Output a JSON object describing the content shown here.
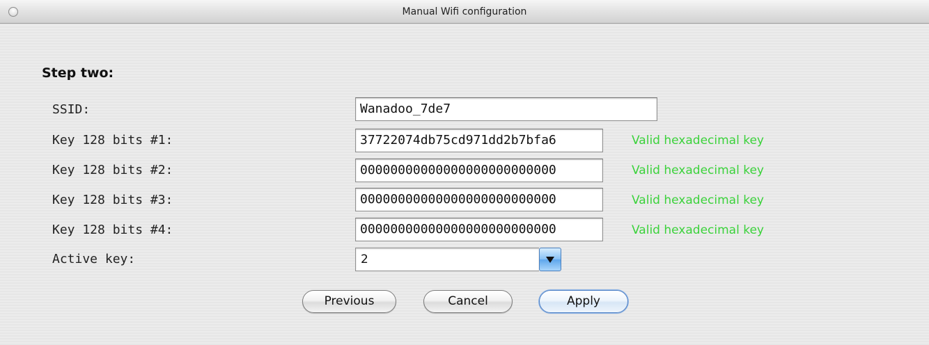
{
  "window": {
    "title": "Manual Wifi configuration"
  },
  "form": {
    "heading": "Step two:",
    "ssid": {
      "label": "SSID:",
      "value": "Wanadoo_7de7"
    },
    "keys": [
      {
        "label": "Key 128 bits #1:",
        "value": "37722074db75cd971dd2b7bfa6",
        "status": "Valid hexadecimal key"
      },
      {
        "label": "Key 128 bits #2:",
        "value": "00000000000000000000000000",
        "status": "Valid hexadecimal key"
      },
      {
        "label": "Key 128 bits #3:",
        "value": "00000000000000000000000000",
        "status": "Valid hexadecimal key"
      },
      {
        "label": "Key 128 bits #4:",
        "value": "00000000000000000000000000",
        "status": "Valid hexadecimal key"
      }
    ],
    "active_key": {
      "label": "Active key:",
      "value": "2"
    }
  },
  "buttons": {
    "previous": "Previous",
    "cancel": "Cancel",
    "apply": "Apply"
  },
  "colors": {
    "valid_status": "#3bd23b",
    "default_button_border": "#4d7fc4"
  },
  "icons": {
    "close": "close-icon",
    "dropdown": "chevron-down-icon"
  }
}
